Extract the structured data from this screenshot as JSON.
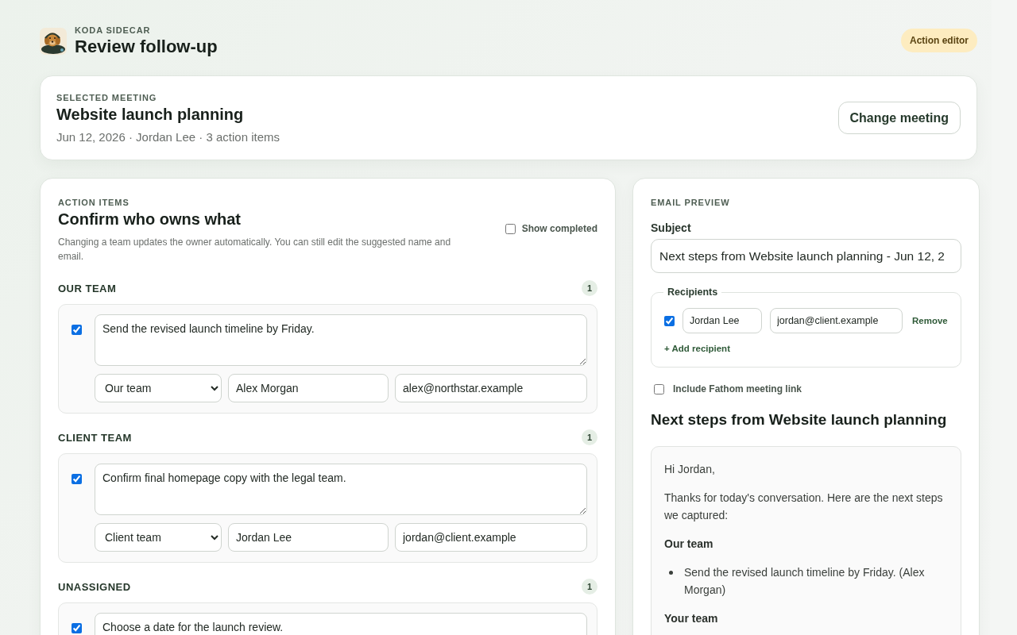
{
  "header": {
    "eyebrow": "KODA SIDECAR",
    "title": "Review follow-up",
    "badge": "Action editor"
  },
  "meeting": {
    "eyebrow": "SELECTED MEETING",
    "title": "Website launch planning",
    "meta": "Jun 12, 2026 · Jordan Lee · 3 action items",
    "button": "Change meeting"
  },
  "action_items": {
    "eyebrow": "ACTION ITEMS",
    "title": "Confirm who owns what",
    "description": "Changing a team updates the owner automatically. You can still edit the suggested name and email.",
    "show_completed": {
      "label": "Show completed",
      "checked": false
    },
    "groups": [
      {
        "title": "OUR TEAM",
        "count": "1",
        "items": [
          {
            "checked": true,
            "text": "Send the revised launch timeline by Friday.",
            "team": "Our team",
            "name": "Alex Morgan",
            "email": "alex@northstar.example"
          }
        ]
      },
      {
        "title": "CLIENT TEAM",
        "count": "1",
        "items": [
          {
            "checked": true,
            "text": "Confirm final homepage copy with the legal team.",
            "team": "Client team",
            "name": "Jordan Lee",
            "email": "jordan@client.example"
          }
        ]
      },
      {
        "title": "UNASSIGNED",
        "count": "1",
        "items": [
          {
            "checked": true,
            "text": "Choose a date for the launch review."
          }
        ]
      }
    ]
  },
  "email_preview": {
    "eyebrow": "EMAIL PREVIEW",
    "subject_label": "Subject",
    "subject": "Next steps from Website launch planning - Jun 12, 2",
    "recipients": {
      "legend": "Recipients",
      "rows": [
        {
          "checked": true,
          "name": "Jordan Lee",
          "email": "jordan@client.example",
          "remove": "Remove"
        }
      ],
      "add": "+ Add recipient"
    },
    "include_link": {
      "label": "Include Fathom meeting link",
      "checked": false
    },
    "heading": "Next steps from Website launch planning",
    "body": [
      {
        "kind": "paragraph",
        "text": "Hi Jordan,"
      },
      {
        "kind": "paragraph",
        "text": "Thanks for today's conversation. Here are the next steps we captured:"
      },
      {
        "kind": "heading",
        "text": "Our team"
      },
      {
        "kind": "bullet",
        "text": "Send the revised launch timeline by Friday. (Alex Morgan)"
      },
      {
        "kind": "heading",
        "text": "Your team"
      }
    ]
  }
}
